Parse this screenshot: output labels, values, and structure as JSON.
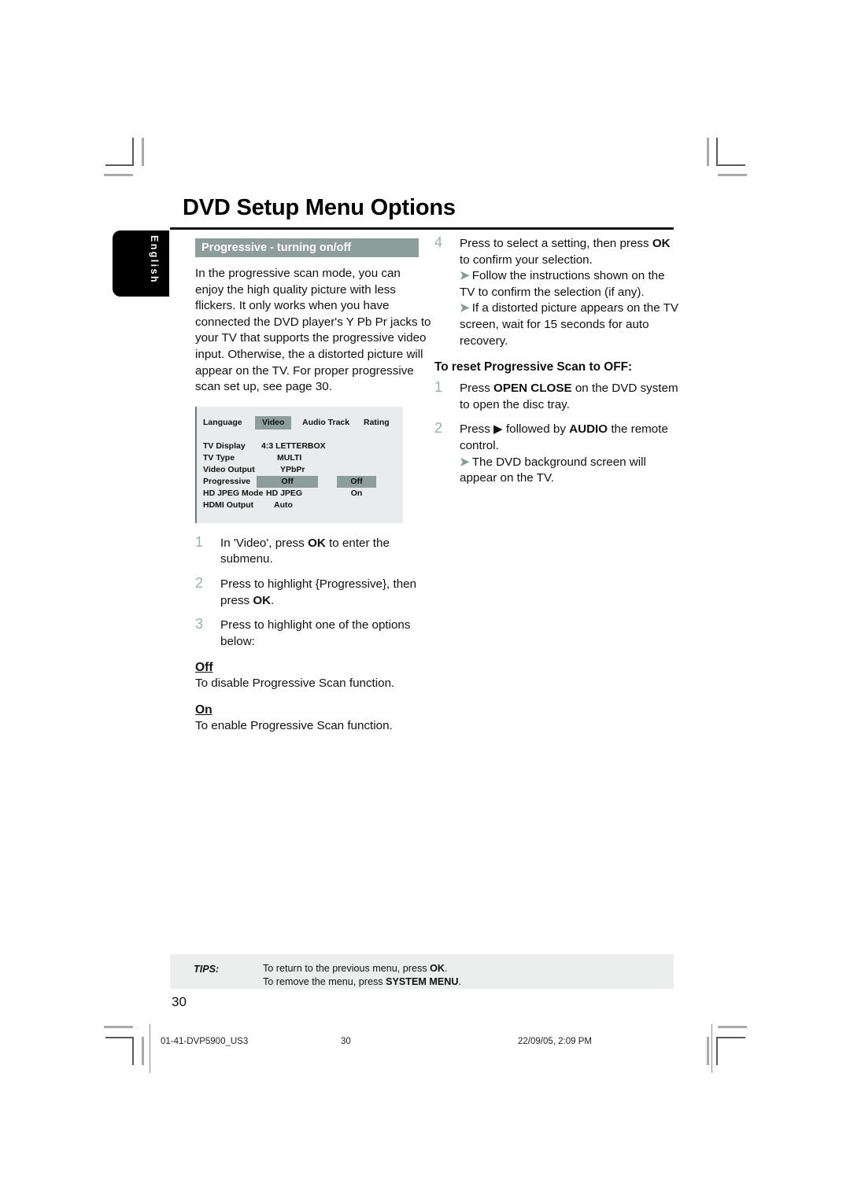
{
  "page": {
    "title": "DVD Setup Menu Options",
    "language_tab": "English",
    "page_number": "30"
  },
  "left_column": {
    "section_banner": "Progressive - turning on/off",
    "intro_paragraph": "In the progressive scan mode, you can enjoy the high quality picture with less flickers. It only works when you have connected the DVD player's Y Pb Pr jacks to your TV that supports the progressive video input. Otherwise, the a distorted picture will appear on the TV. For proper progressive scan set up, see page 30.",
    "steps": [
      {
        "num": "1",
        "text_pre": "In 'Video', press ",
        "bold": "OK",
        "text_post": " to enter the submenu."
      },
      {
        "num": "2",
        "text_pre": "Press          to highlight {Progressive}, then press ",
        "bold": "OK",
        "text_post": "."
      },
      {
        "num": "3",
        "text_pre": "Press          to highlight one of the options below:",
        "bold": "",
        "text_post": ""
      }
    ],
    "options": [
      {
        "name": "Off",
        "desc": "To disable Progressive Scan function."
      },
      {
        "name": "On",
        "desc": "To enable Progressive Scan function."
      }
    ]
  },
  "dvd_menu": {
    "tabs": [
      {
        "label": "Language",
        "selected": false
      },
      {
        "label": "Video",
        "selected": true
      },
      {
        "label": "Audio Track",
        "selected": false
      },
      {
        "label": "Rating",
        "selected": false
      }
    ],
    "rows": [
      {
        "label": "TV Display",
        "value": "4:3 LETTERBOX",
        "highlighted": false
      },
      {
        "label": "TV Type",
        "value": "MULTI",
        "highlighted": false
      },
      {
        "label": "Video Output",
        "value": "YPbPr",
        "highlighted": false
      },
      {
        "label": "Progressive",
        "value": "Off",
        "highlighted": true
      },
      {
        "label": "HD JPEG Mode",
        "value": "HD JPEG",
        "highlighted": false
      },
      {
        "label": "HDMI Output",
        "value": "Auto",
        "highlighted": false
      }
    ],
    "submenu": {
      "options": [
        "Off",
        "On"
      ],
      "selected": "Off"
    },
    "colors": {
      "highlight": "#8d9e9a",
      "background": "#e9ecec"
    }
  },
  "right_column": {
    "step4": {
      "num": "4",
      "line1_pre": "Press          to select a setting, then press ",
      "line1_bold": "OK",
      "line1_post": " to confirm your selection.",
      "bullets": [
        "Follow the instructions shown on the TV to confirm the selection (if any).",
        "If a distorted picture appears on the TV screen, wait for 15 seconds for auto recovery."
      ]
    },
    "subhead": "To reset Progressive Scan to OFF:",
    "steps": [
      {
        "num": "1",
        "pre": "Press ",
        "bold": "OPEN CLOSE",
        "post": "      on the DVD system to open the disc tray.",
        "bullets": []
      },
      {
        "num": "2",
        "pre": "Press ▶ followed by ",
        "bold": "AUDIO",
        "post": " the remote control.",
        "bullets": [
          "The DVD background screen will appear on the TV."
        ]
      }
    ]
  },
  "tips": {
    "label": "TIPS:",
    "line1_pre": "To return to the previous menu, press ",
    "line1_bold": "OK",
    "line1_post": ".",
    "line2_pre": "To remove the menu, press ",
    "line2_bold": "SYSTEM MENU",
    "line2_post": "."
  },
  "print_footer": {
    "file": "01-41-DVP5900_US3",
    "page": "30",
    "date": "22/09/05, 2:09 PM"
  },
  "colors": {
    "accent": "#8d9e9a",
    "step_number": "#9bb0ae",
    "arrow": "#7f9c99",
    "tips_bg": "#eceeee"
  }
}
